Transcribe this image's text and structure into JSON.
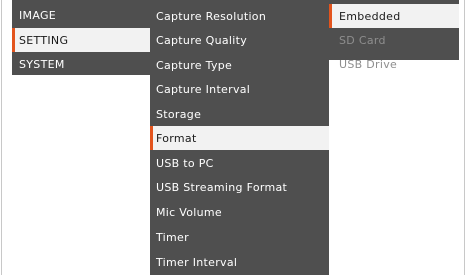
{
  "main_menu": {
    "items": [
      {
        "label": "IMAGE",
        "selected": false
      },
      {
        "label": "SETTING",
        "selected": true
      },
      {
        "label": "SYSTEM",
        "selected": false
      }
    ]
  },
  "setting_menu": {
    "items": [
      {
        "label": "Capture Resolution",
        "selected": false
      },
      {
        "label": "Capture Quality",
        "selected": false
      },
      {
        "label": "Capture Type",
        "selected": false
      },
      {
        "label": "Capture Interval",
        "selected": false
      },
      {
        "label": "Storage",
        "selected": false
      },
      {
        "label": "Format",
        "selected": true
      },
      {
        "label": "USB to PC",
        "selected": false
      },
      {
        "label": "USB Streaming Format",
        "selected": false
      },
      {
        "label": "Mic Volume",
        "selected": false
      },
      {
        "label": "Timer",
        "selected": false
      },
      {
        "label": "Timer Interval",
        "selected": false
      }
    ]
  },
  "format_submenu": {
    "items": [
      {
        "label": "Embedded",
        "selected": true,
        "enabled": true
      },
      {
        "label": "SD Card",
        "selected": false,
        "enabled": false
      },
      {
        "label": "USB Drive",
        "selected": false,
        "enabled": false
      }
    ]
  },
  "colors": {
    "panel_bg": "#4f4f4f",
    "selected_bg": "#f2f2f2",
    "accent": "#e3541d",
    "text": "#ffffff",
    "disabled_text": "#8e8e8e"
  }
}
